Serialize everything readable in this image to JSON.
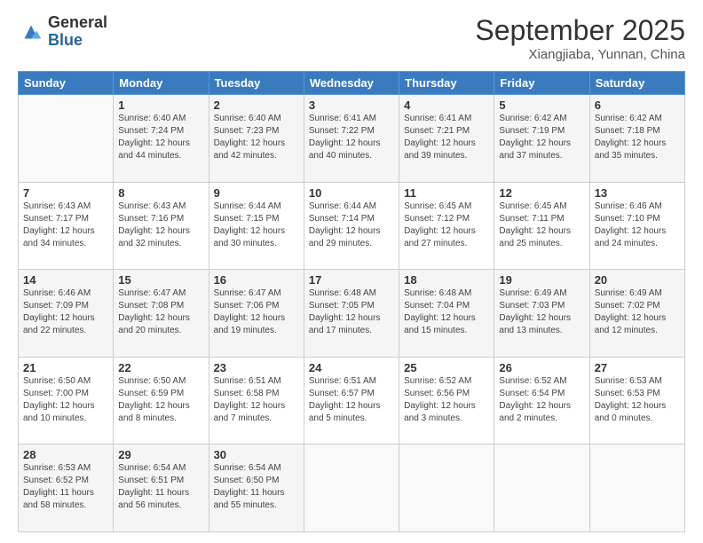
{
  "header": {
    "logo_line1": "General",
    "logo_line2": "Blue",
    "month": "September 2025",
    "location": "Xiangjiaba, Yunnan, China"
  },
  "days_of_week": [
    "Sunday",
    "Monday",
    "Tuesday",
    "Wednesday",
    "Thursday",
    "Friday",
    "Saturday"
  ],
  "weeks": [
    [
      {
        "day": "",
        "info": ""
      },
      {
        "day": "1",
        "info": "Sunrise: 6:40 AM\nSunset: 7:24 PM\nDaylight: 12 hours\nand 44 minutes."
      },
      {
        "day": "2",
        "info": "Sunrise: 6:40 AM\nSunset: 7:23 PM\nDaylight: 12 hours\nand 42 minutes."
      },
      {
        "day": "3",
        "info": "Sunrise: 6:41 AM\nSunset: 7:22 PM\nDaylight: 12 hours\nand 40 minutes."
      },
      {
        "day": "4",
        "info": "Sunrise: 6:41 AM\nSunset: 7:21 PM\nDaylight: 12 hours\nand 39 minutes."
      },
      {
        "day": "5",
        "info": "Sunrise: 6:42 AM\nSunset: 7:19 PM\nDaylight: 12 hours\nand 37 minutes."
      },
      {
        "day": "6",
        "info": "Sunrise: 6:42 AM\nSunset: 7:18 PM\nDaylight: 12 hours\nand 35 minutes."
      }
    ],
    [
      {
        "day": "7",
        "info": "Sunrise: 6:43 AM\nSunset: 7:17 PM\nDaylight: 12 hours\nand 34 minutes."
      },
      {
        "day": "8",
        "info": "Sunrise: 6:43 AM\nSunset: 7:16 PM\nDaylight: 12 hours\nand 32 minutes."
      },
      {
        "day": "9",
        "info": "Sunrise: 6:44 AM\nSunset: 7:15 PM\nDaylight: 12 hours\nand 30 minutes."
      },
      {
        "day": "10",
        "info": "Sunrise: 6:44 AM\nSunset: 7:14 PM\nDaylight: 12 hours\nand 29 minutes."
      },
      {
        "day": "11",
        "info": "Sunrise: 6:45 AM\nSunset: 7:12 PM\nDaylight: 12 hours\nand 27 minutes."
      },
      {
        "day": "12",
        "info": "Sunrise: 6:45 AM\nSunset: 7:11 PM\nDaylight: 12 hours\nand 25 minutes."
      },
      {
        "day": "13",
        "info": "Sunrise: 6:46 AM\nSunset: 7:10 PM\nDaylight: 12 hours\nand 24 minutes."
      }
    ],
    [
      {
        "day": "14",
        "info": "Sunrise: 6:46 AM\nSunset: 7:09 PM\nDaylight: 12 hours\nand 22 minutes."
      },
      {
        "day": "15",
        "info": "Sunrise: 6:47 AM\nSunset: 7:08 PM\nDaylight: 12 hours\nand 20 minutes."
      },
      {
        "day": "16",
        "info": "Sunrise: 6:47 AM\nSunset: 7:06 PM\nDaylight: 12 hours\nand 19 minutes."
      },
      {
        "day": "17",
        "info": "Sunrise: 6:48 AM\nSunset: 7:05 PM\nDaylight: 12 hours\nand 17 minutes."
      },
      {
        "day": "18",
        "info": "Sunrise: 6:48 AM\nSunset: 7:04 PM\nDaylight: 12 hours\nand 15 minutes."
      },
      {
        "day": "19",
        "info": "Sunrise: 6:49 AM\nSunset: 7:03 PM\nDaylight: 12 hours\nand 13 minutes."
      },
      {
        "day": "20",
        "info": "Sunrise: 6:49 AM\nSunset: 7:02 PM\nDaylight: 12 hours\nand 12 minutes."
      }
    ],
    [
      {
        "day": "21",
        "info": "Sunrise: 6:50 AM\nSunset: 7:00 PM\nDaylight: 12 hours\nand 10 minutes."
      },
      {
        "day": "22",
        "info": "Sunrise: 6:50 AM\nSunset: 6:59 PM\nDaylight: 12 hours\nand 8 minutes."
      },
      {
        "day": "23",
        "info": "Sunrise: 6:51 AM\nSunset: 6:58 PM\nDaylight: 12 hours\nand 7 minutes."
      },
      {
        "day": "24",
        "info": "Sunrise: 6:51 AM\nSunset: 6:57 PM\nDaylight: 12 hours\nand 5 minutes."
      },
      {
        "day": "25",
        "info": "Sunrise: 6:52 AM\nSunset: 6:56 PM\nDaylight: 12 hours\nand 3 minutes."
      },
      {
        "day": "26",
        "info": "Sunrise: 6:52 AM\nSunset: 6:54 PM\nDaylight: 12 hours\nand 2 minutes."
      },
      {
        "day": "27",
        "info": "Sunrise: 6:53 AM\nSunset: 6:53 PM\nDaylight: 12 hours\nand 0 minutes."
      }
    ],
    [
      {
        "day": "28",
        "info": "Sunrise: 6:53 AM\nSunset: 6:52 PM\nDaylight: 11 hours\nand 58 minutes."
      },
      {
        "day": "29",
        "info": "Sunrise: 6:54 AM\nSunset: 6:51 PM\nDaylight: 11 hours\nand 56 minutes."
      },
      {
        "day": "30",
        "info": "Sunrise: 6:54 AM\nSunset: 6:50 PM\nDaylight: 11 hours\nand 55 minutes."
      },
      {
        "day": "",
        "info": ""
      },
      {
        "day": "",
        "info": ""
      },
      {
        "day": "",
        "info": ""
      },
      {
        "day": "",
        "info": ""
      }
    ]
  ]
}
